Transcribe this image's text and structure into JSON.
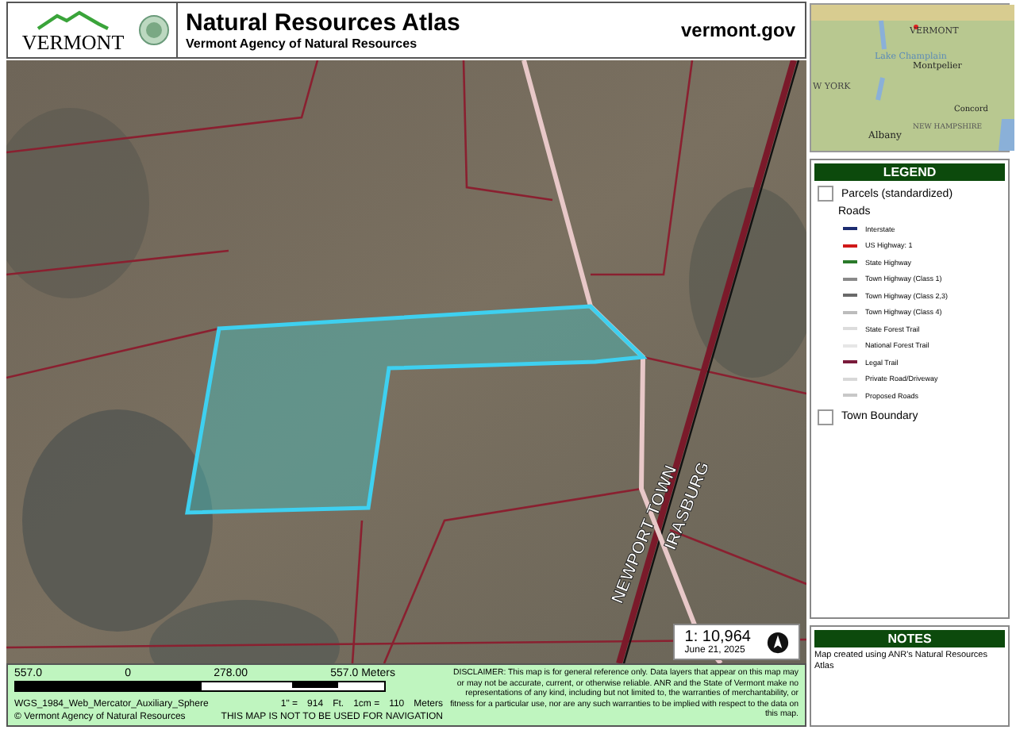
{
  "header": {
    "title": "Natural Resources Atlas",
    "subtitle": "Vermont Agency of Natural Resources",
    "logo_text": "VERMONT",
    "site": "vermont.gov"
  },
  "map": {
    "labels": [
      {
        "text": "NEWPORT TOWN",
        "kind": "town"
      },
      {
        "text": "IRASBURG",
        "kind": "town"
      }
    ],
    "scale": "1: 10,964",
    "date": "June 21, 2025"
  },
  "inset_map": {
    "labels": [
      "VERMONT",
      "Lake Champlain",
      "Montpelier",
      "W YORK",
      "Concord",
      "NEW HAMPSHIRE",
      "Albany"
    ]
  },
  "legend": {
    "title": "LEGEND",
    "items": [
      {
        "kind": "box",
        "label": "Parcels (standardized)"
      },
      {
        "kind": "heading",
        "label": "Roads"
      },
      {
        "kind": "line",
        "label": "Interstate",
        "color": "#1c2c70"
      },
      {
        "kind": "line",
        "label": "US Highway: 1",
        "color": "#d01818"
      },
      {
        "kind": "line",
        "label": "State Highway",
        "color": "#2a7a2a"
      },
      {
        "kind": "line",
        "label": "Town Highway (Class 1)",
        "color": "#8a8a8a"
      },
      {
        "kind": "line",
        "label": "Town Highway (Class 2,3)",
        "color": "#6a6a6a"
      },
      {
        "kind": "line",
        "label": "Town Highway (Class 4)",
        "color": "#bcbcbc"
      },
      {
        "kind": "line",
        "label": "State Forest Trail",
        "color": "#dcdcdc"
      },
      {
        "kind": "line",
        "label": "National Forest Trail",
        "color": "#e6e6e6"
      },
      {
        "kind": "line",
        "label": "Legal Trail",
        "color": "#7a1a3a"
      },
      {
        "kind": "line",
        "label": "Private Road/Driveway",
        "color": "#d8d8d8"
      },
      {
        "kind": "line",
        "label": "Proposed Roads",
        "color": "#c8c8c8"
      },
      {
        "kind": "box",
        "label": "Town Boundary"
      }
    ]
  },
  "notes": {
    "title": "NOTES",
    "text": "Map created using ANR's Natural Resources Atlas"
  },
  "footer": {
    "scale_labels": [
      "557.0",
      "0",
      "278.00",
      "557.0 Meters"
    ],
    "projection": "WGS_1984_Web_Mercator_Auxiliary_Sphere",
    "ratio": [
      "1\" =",
      "914",
      "Ft.",
      "1cm =",
      "110",
      "Meters"
    ],
    "copyright": "© Vermont Agency of Natural Resources",
    "warning": "THIS MAP IS NOT TO BE USED FOR NAVIGATION",
    "disclaimer": "DISCLAIMER: This map is for general reference only. Data layers that appear on this map may or may not be accurate, current, or otherwise reliable. ANR and the State of Vermont make no representations of any kind, including but not limited to, the warranties of merchantability, or fitness for a particular use, nor are any such warranties to be implied with respect to the data on this map."
  }
}
